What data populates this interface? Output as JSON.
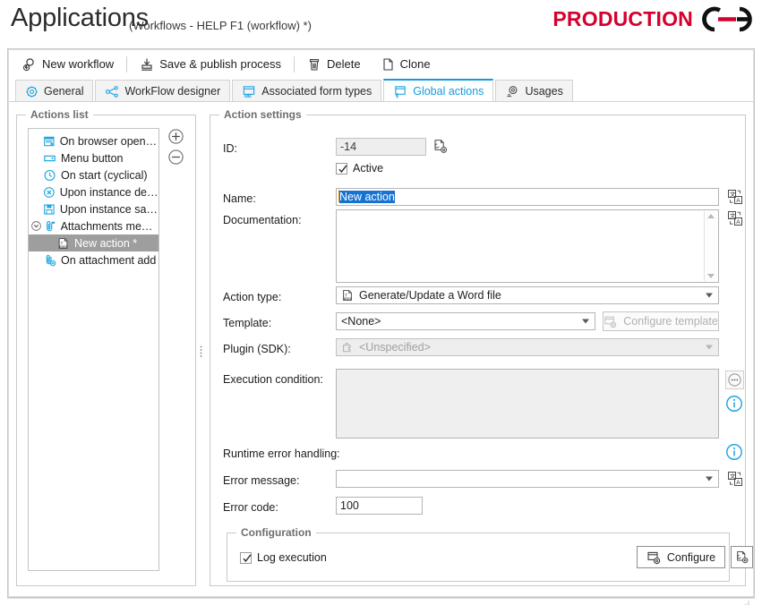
{
  "header": {
    "title": "Applications",
    "subtitle": "(Workflows - HELP F1 (workflow) *)",
    "brand": "PRODUCTION",
    "brand_color": "#d6002e",
    "logo_icon": "chain-link-icon"
  },
  "toolbar": {
    "items": [
      {
        "label": "New workflow",
        "icon": "new-workflow-icon"
      },
      {
        "label": "Save & publish process",
        "icon": "save-publish-icon"
      },
      {
        "label": "Delete",
        "icon": "trash-icon"
      },
      {
        "label": "Clone",
        "icon": "clone-page-icon"
      }
    ]
  },
  "tabs": {
    "active": "Global actions",
    "items": [
      {
        "label": "General",
        "icon": "gear-icon",
        "active": false
      },
      {
        "label": "WorkFlow designer",
        "icon": "workflow-nodes-icon",
        "active": false
      },
      {
        "label": "Associated form types",
        "icon": "form-types-icon",
        "active": false
      },
      {
        "label": "Global actions",
        "icon": "global-actions-icon",
        "active": true
      },
      {
        "label": "Usages",
        "icon": "usages-icon",
        "active": false
      }
    ],
    "active_color": "#129ce0"
  },
  "actions_panel": {
    "title": "Actions list",
    "add_button": "add-action-button",
    "remove_button": "remove-action-button",
    "items": [
      {
        "label": "On browser opening *",
        "icon": "browser-opening-icon",
        "child": false,
        "selected": false,
        "expander": false
      },
      {
        "label": "Menu button",
        "icon": "menu-button-icon",
        "child": false,
        "selected": false,
        "expander": false
      },
      {
        "label": "On start (cyclical)",
        "icon": "clock-icon",
        "child": false,
        "selected": false,
        "expander": false
      },
      {
        "label": "Upon instance delet...",
        "icon": "delete-circle-icon",
        "child": false,
        "selected": false,
        "expander": false
      },
      {
        "label": "Upon instance saving",
        "icon": "save-disk-icon",
        "child": false,
        "selected": false,
        "expander": false
      },
      {
        "label": "Attachments menu *",
        "icon": "attachments-menu-icon",
        "child": false,
        "selected": false,
        "expander": true
      },
      {
        "label": "New action *",
        "icon": "word-docx-icon",
        "child": true,
        "selected": true,
        "expander": false
      },
      {
        "label": "On attachment add",
        "icon": "attachment-add-icon",
        "child": false,
        "selected": false,
        "expander": false
      }
    ]
  },
  "settings": {
    "title": "Action settings",
    "id_label": "ID:",
    "id_value": "-14",
    "id_copy_icon": "copy-settings-icon",
    "active_label": "Active",
    "active_checked": true,
    "name_label": "Name:",
    "name_value": "New action",
    "name_selected": true,
    "name_translate_icon": "translate-icon",
    "documentation_label": "Documentation:",
    "documentation_value": "",
    "documentation_translate_icon": "translate-icon",
    "action_type_label": "Action type:",
    "action_type_value": "Generate/Update a Word file",
    "action_type_icon": "word-docx-icon",
    "template_label": "Template:",
    "template_value": "<None>",
    "configure_template_label": "Configure template",
    "configure_template_icon": "configure-template-icon",
    "configure_template_disabled": true,
    "plugin_label": "Plugin (SDK):",
    "plugin_value": "<Unspecified>",
    "plugin_icon": "puzzle-icon",
    "plugin_disabled": true,
    "execution_condition_label": "Execution condition:",
    "execution_condition_value": "",
    "execution_ellipsis_icon": "ellipsis-icon",
    "execution_info_icon": "info-icon",
    "runtime_error_label": "Runtime error handling:",
    "runtime_info_icon": "info-icon",
    "error_message_label": "Error message:",
    "error_message_value": "",
    "error_message_translate_icon": "translate-icon",
    "error_code_label": "Error code:",
    "error_code_value": "100",
    "configuration_title": "Configuration",
    "log_execution_label": "Log execution",
    "log_execution_checked": true,
    "configure_button_label": "Configure",
    "configure_button_icon": "configure-icon",
    "configure_extra_icon": "configure-settings-icon"
  }
}
